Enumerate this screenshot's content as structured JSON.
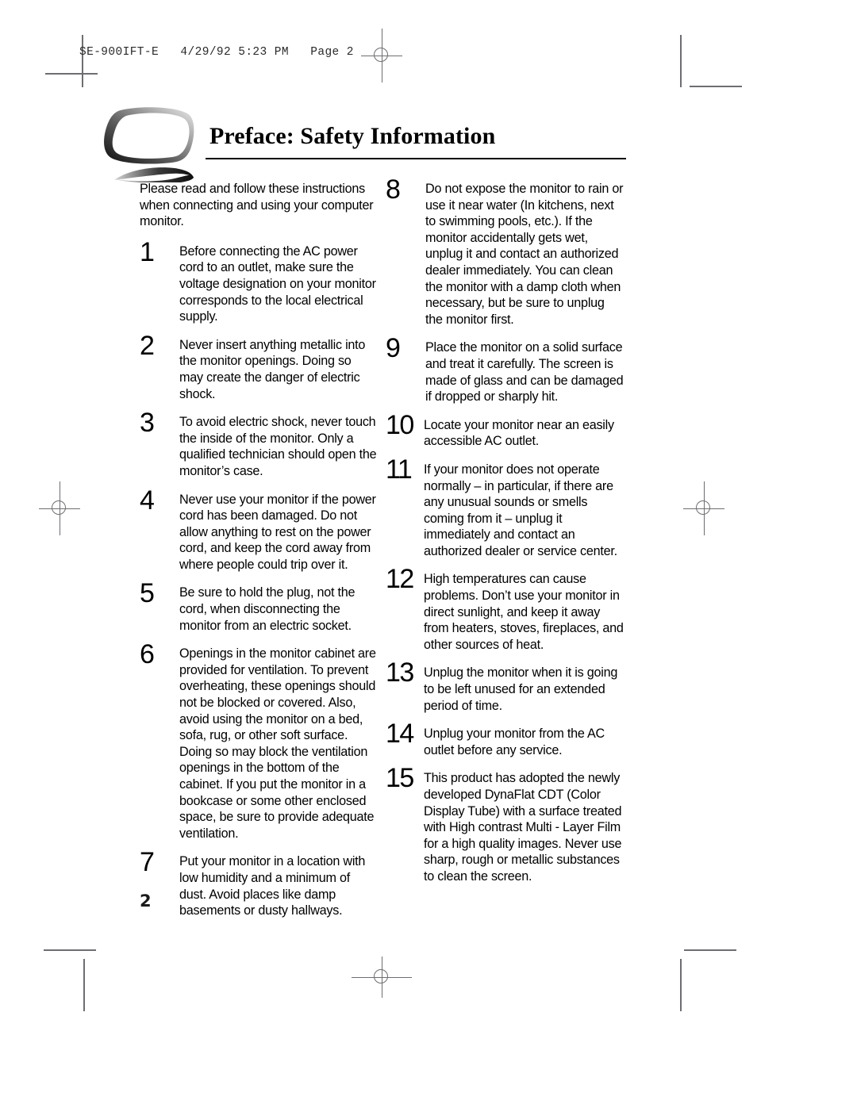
{
  "slug": "SE-900IFT-E   4/29/92 5:23 PM   Page 2",
  "header": {
    "title": "Preface: Safety Information",
    "logo_name": "monitor-swoosh-logo"
  },
  "intro": "Please read and follow these instructions when connecting and using your computer monitor.",
  "page_number": "2",
  "colors": {
    "text": "#000000",
    "crop_mark": "#6e6e72",
    "rule": "#000000"
  },
  "left_column": [
    {
      "number": "1",
      "text": "Before connecting the AC power cord to an outlet, make sure the voltage designation on your monitor corresponds to the local electrical supply."
    },
    {
      "number": "2",
      "text": "Never insert anything metallic into the monitor openings. Doing so may create the danger of electric shock."
    },
    {
      "number": "3",
      "text": "To avoid electric shock, never touch the inside of the monitor. Only a qualified technician should open the monitor’s case."
    },
    {
      "number": "4",
      "text": "Never use your monitor if the power cord has been damaged. Do not allow anything to rest on the power cord, and keep the cord away from where people could trip over it."
    },
    {
      "number": "5",
      "text": "Be sure to hold the plug, not the cord, when disconnecting the monitor from an electric socket."
    },
    {
      "number": "6",
      "text": "Openings in the monitor cabinet are provided for ventilation. To prevent overheating, these openings should not be blocked or covered. Also, avoid using the monitor on a bed, sofa, rug, or other soft surface. Doing so may block the ventilation openings in the bottom of the cabinet. If you put the monitor in a bookcase or some other enclosed space, be sure to provide adequate ventilation."
    },
    {
      "number": "7",
      "text": "Put your monitor in a location with low humidity and a minimum of dust. Avoid places like damp basements or dusty hallways."
    }
  ],
  "right_column": [
    {
      "number": "8",
      "text": "Do not expose the monitor to rain or use it near water (In kitchens, next to swimming pools, etc.). If the monitor accidentally gets wet, unplug it and contact an authorized dealer immediately. You can clean the monitor with a damp cloth when necessary, but be sure to unplug the monitor first."
    },
    {
      "number": "9",
      "text": "Place the monitor on a solid surface and treat it carefully. The screen is made of glass and can be damaged if dropped or sharply hit."
    },
    {
      "number": "10",
      "text": "Locate your monitor near an easily accessible AC outlet."
    },
    {
      "number": "11",
      "text": "If your monitor does not operate normally – in particular, if there are any unusual sounds or smells coming from it – unplug it immediately and contact an authorized dealer or service center."
    },
    {
      "number": "12",
      "text": "High temperatures can cause problems. Don’t use your monitor in direct sunlight, and keep it away from heaters, stoves, fireplaces, and other sources of heat."
    },
    {
      "number": "13",
      "text": "Unplug the monitor when it is going to be left unused for an extended period of time."
    },
    {
      "number": "14",
      "text": "Unplug your monitor from the AC outlet before any service."
    },
    {
      "number": "15",
      "text": "This product has adopted the newly developed DynaFlat CDT (Color Display Tube) with a surface treated with High contrast Multi - Layer Film for a high quality images. Never use sharp, rough or metallic substances to clean the screen."
    }
  ]
}
